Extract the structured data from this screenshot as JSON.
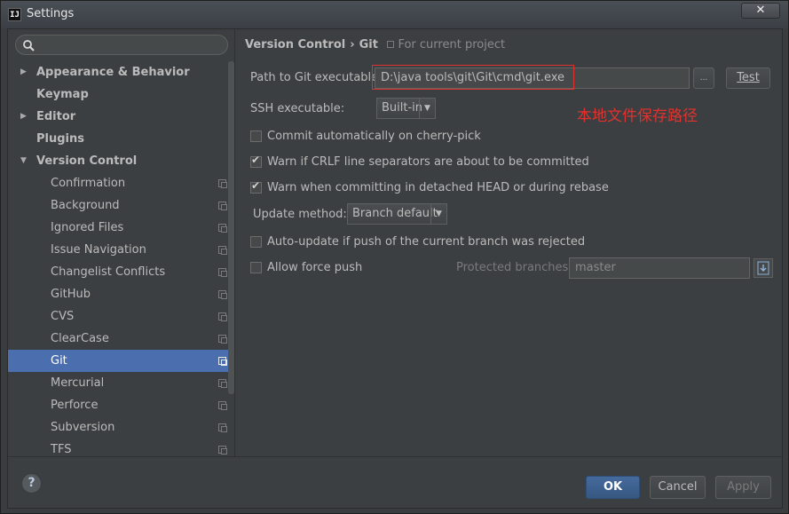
{
  "window": {
    "title": "Settings",
    "app_icon": "IJ",
    "close_symbol": "✕"
  },
  "search": {
    "placeholder": "",
    "value": ""
  },
  "sidebar": {
    "items": [
      {
        "label": "Appearance & Behavior",
        "arrow": "▶"
      },
      {
        "label": "Keymap",
        "arrow": ""
      },
      {
        "label": "Editor",
        "arrow": "▶"
      },
      {
        "label": "Plugins",
        "arrow": ""
      },
      {
        "label": "Version Control",
        "arrow": "▼"
      },
      {
        "label": "Confirmation"
      },
      {
        "label": "Background"
      },
      {
        "label": "Ignored Files"
      },
      {
        "label": "Issue Navigation"
      },
      {
        "label": "Changelist Conflicts"
      },
      {
        "label": "GitHub"
      },
      {
        "label": "CVS"
      },
      {
        "label": "ClearCase"
      },
      {
        "label": "Git",
        "selected": true
      },
      {
        "label": "Mercurial"
      },
      {
        "label": "Perforce"
      },
      {
        "label": "Subversion"
      },
      {
        "label": "TFS"
      }
    ]
  },
  "breadcrumb": {
    "parent": "Version Control",
    "separator": "›",
    "current": "Git",
    "note": "For current project"
  },
  "git": {
    "path_label": "Path to Git executable:",
    "path_value": "D:\\java tools\\git\\Git\\cmd\\git.exe",
    "browse_label": "...",
    "test_label": "Test",
    "ssh_label": "SSH executable:",
    "ssh_value": "Built-in",
    "annotation": "本地文件保存路径",
    "cherry_pick_label": "Commit automatically on cherry-pick",
    "cherry_pick_checked": false,
    "crlf_label": "Warn if CRLF line separators are about to be committed",
    "crlf_checked": true,
    "detached_label": "Warn when committing in detached HEAD or during rebase",
    "detached_checked": true,
    "update_label": "Update method:",
    "update_value": "Branch default",
    "autoupdate_label": "Auto-update if push of the current branch was rejected",
    "autoupdate_checked": false,
    "force_push_label": "Allow force push",
    "force_push_checked": false,
    "protected_label": "Protected branches:",
    "protected_value": "master"
  },
  "footer": {
    "help": "?",
    "ok": "OK",
    "cancel": "Cancel",
    "apply": "Apply"
  },
  "colors": {
    "accent": "#4b6eaf",
    "annotation": "#e0322e",
    "background": "#3c3f41"
  }
}
